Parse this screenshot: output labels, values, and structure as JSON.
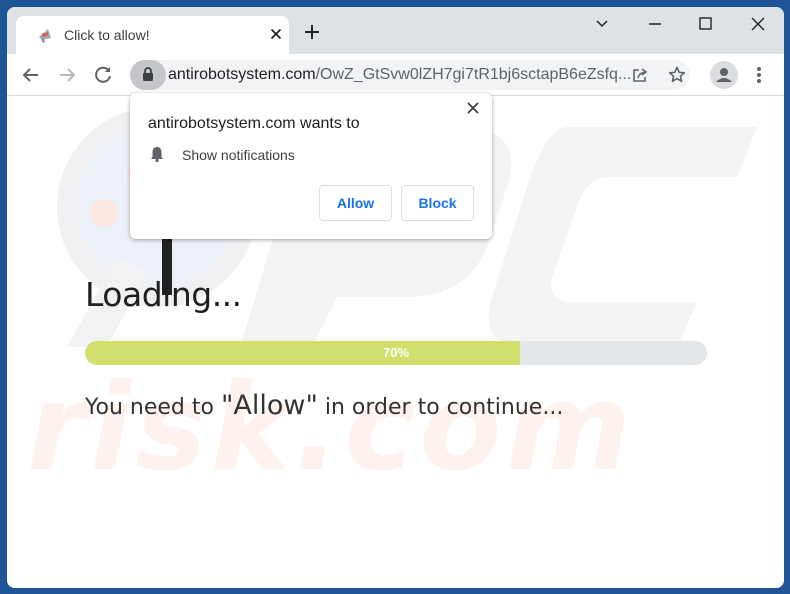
{
  "browser": {
    "tab": {
      "title": "Click to allow!",
      "favicon": "megaphone-icon"
    },
    "new_tab_icon": "plus-icon",
    "window_controls": [
      "chevron-down-icon",
      "minimize-icon",
      "maximize-icon",
      "close-icon"
    ],
    "nav": {
      "back": "back-arrow-icon",
      "forward": "forward-arrow-icon",
      "reload": "reload-icon"
    },
    "address": {
      "host": "antirobotsystem.com",
      "path": "/OwZ_GtSvw0lZH7gi7tR1bj6sctapB6eZsfq..."
    }
  },
  "permission_popup": {
    "title": "antirobotsystem.com wants to",
    "permission": "Show notifications",
    "allow_label": "Allow",
    "block_label": "Block"
  },
  "page": {
    "loading_text": "Loading...",
    "progress": {
      "percent": 70,
      "label": "70%"
    },
    "message_before": "You need to ",
    "message_highlight": "\"Allow\"",
    "message_after": " in order to continue..."
  },
  "watermark": {
    "text": "risk.com"
  },
  "colors": {
    "progress_fill": "#d2df6e",
    "progress_track": "#e4e7ea",
    "button_text": "#1a73e8",
    "desktop": "#1f5597"
  }
}
